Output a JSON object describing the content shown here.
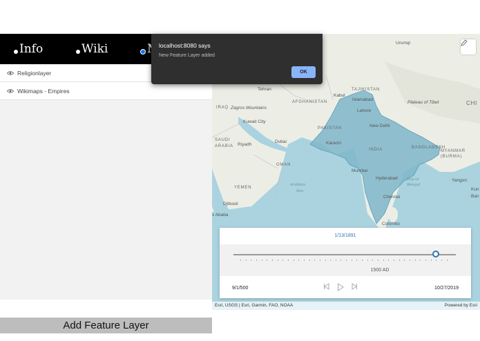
{
  "nav": {
    "items": [
      {
        "label": "Info"
      },
      {
        "label": "Wiki"
      },
      {
        "label": "M"
      }
    ]
  },
  "layers": [
    {
      "label": "Religionlayer"
    },
    {
      "label": "Wikimaps - Empires"
    }
  ],
  "add_button": {
    "label": "Add Feature Layer"
  },
  "map": {
    "labels": {
      "urumqi": "Urumqi",
      "tehran": "Tehran",
      "iraq": "IRAQ",
      "zagros": "Zagros Mountains",
      "afghanistan": "AFGHANISTAN",
      "kabul": "Kabul",
      "islamabad": "Islamabad",
      "tajikistan": "TAJIKISTAN",
      "plateau": "Plateau of Tibet",
      "chi": "CHI",
      "lahore": "Lahore",
      "pakistan": "PAKISTAN",
      "new_delhi": "New Delhi",
      "kuwait": "Kuwait City",
      "saudi1": "SAUDI",
      "saudi2": "ARABIA",
      "riyadh": "Riyadh",
      "dubai": "Dubai",
      "karachi": "Karachi",
      "india": "INDIA",
      "bangladesh": "BANGLADESH",
      "myanmar1": "MYANMAR",
      "myanmar2": "(BURMA)",
      "oman": "OMAN",
      "mumbai": "Mumbai",
      "hyderabad": "Hyderabad",
      "yangon": "Yangon",
      "kun": "Kun",
      "yemen": "YEMEN",
      "arabian_sea1": "Arabian",
      "arabian_sea2": "Sea",
      "bay1": "Bay of",
      "bay2": "Bengal",
      "chennai": "Chennai",
      "djibouti": "Djibouti",
      "addis": "s Ababa",
      "colombo": "Colombo",
      "ban": "Ban"
    },
    "attribution_left": "Esri, USGS | Esri, Garmin, FAO, NOAA",
    "attribution_right": "Powered by Esri",
    "colors": {
      "land": "#eceee6",
      "water": "#aad3df",
      "feature": "#7fb6c9"
    }
  },
  "time_slider": {
    "current_date": "1/13/1891",
    "mid_label": "1500 AD",
    "start": "9/1/500",
    "end": "10/27/2019",
    "position_fraction": 0.91
  },
  "alert": {
    "title": "localhost:8080 says",
    "message": "New Feature Layer added",
    "ok_label": "OK"
  }
}
